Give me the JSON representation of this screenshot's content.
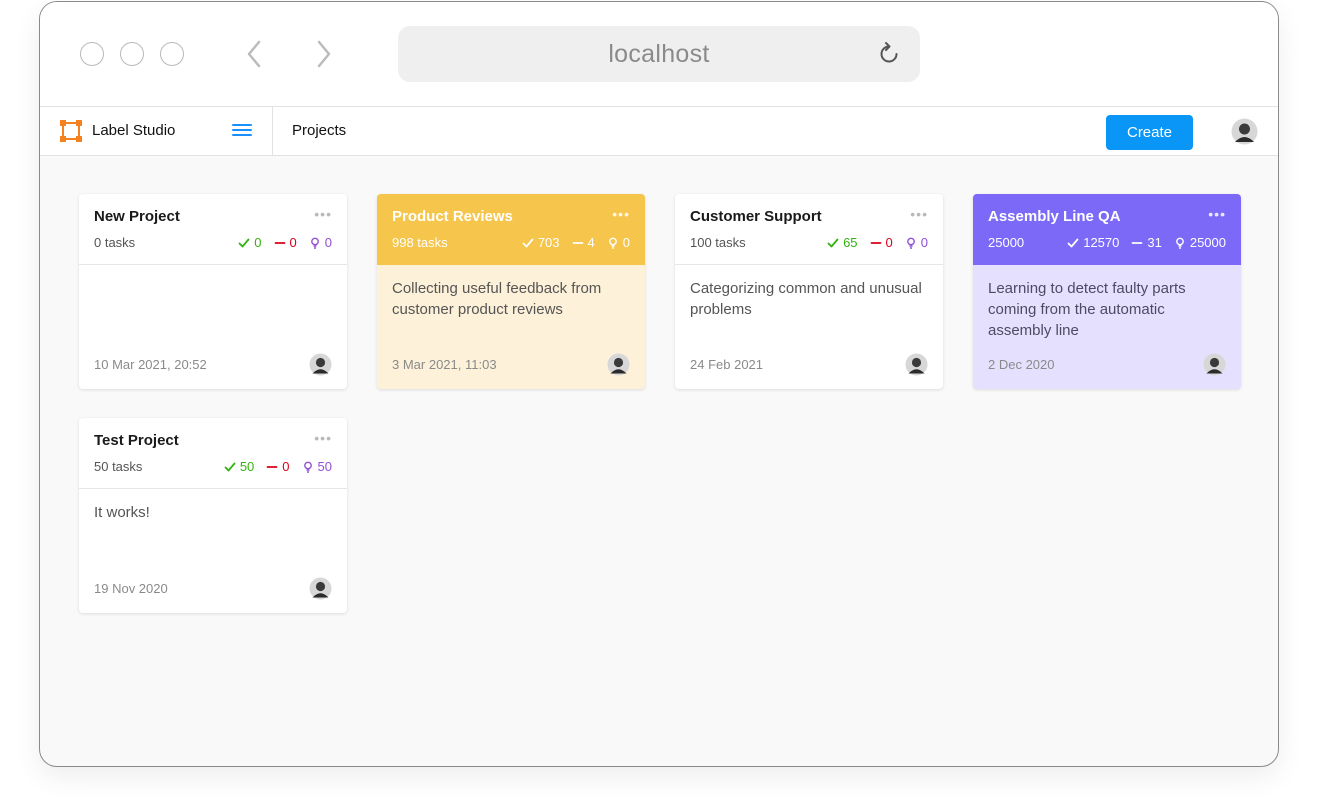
{
  "browser": {
    "url": "localhost"
  },
  "app": {
    "name": "Label Studio",
    "breadcrumb": "Projects",
    "create_label": "Create"
  },
  "colors": {
    "accent": "#0996f6",
    "completed": "#33b310",
    "skipped": "#d9001b",
    "predictions": "#9150d6",
    "yellow_header": "#f6c54b",
    "purple_header": "#7c69f8"
  },
  "projects": [
    {
      "title": "New Project",
      "tasks": "0 tasks",
      "completed": "0",
      "skipped": "0",
      "predictions": "0",
      "description": "",
      "date": "10 Mar 2021, 20:52",
      "color": "white",
      "menu": "•••"
    },
    {
      "title": "Product Reviews",
      "tasks": "998 tasks",
      "completed": "703",
      "skipped": "4",
      "predictions": "0",
      "description": "Collecting useful feedback from customer product reviews",
      "date": "3 Mar 2021, 11:03",
      "color": "yellow",
      "menu": "•••"
    },
    {
      "title": "Customer Support",
      "tasks": "100 tasks",
      "completed": "65",
      "skipped": "0",
      "predictions": "0",
      "description": "Categorizing common and unusual problems",
      "date": "24 Feb 2021",
      "color": "white",
      "menu": "•••"
    },
    {
      "title": "Assembly Line QA",
      "tasks": "25000",
      "completed": "12570",
      "skipped": "31",
      "predictions": "25000",
      "description": "Learning to detect faulty parts coming from the automatic assembly line",
      "date": "2 Dec 2020",
      "color": "purple",
      "menu": "•••"
    },
    {
      "title": "Test Project",
      "tasks": "50 tasks",
      "completed": "50",
      "skipped": "0",
      "predictions": "50",
      "description": "It works!",
      "date": "19 Nov 2020",
      "color": "white",
      "menu": "•••"
    }
  ]
}
